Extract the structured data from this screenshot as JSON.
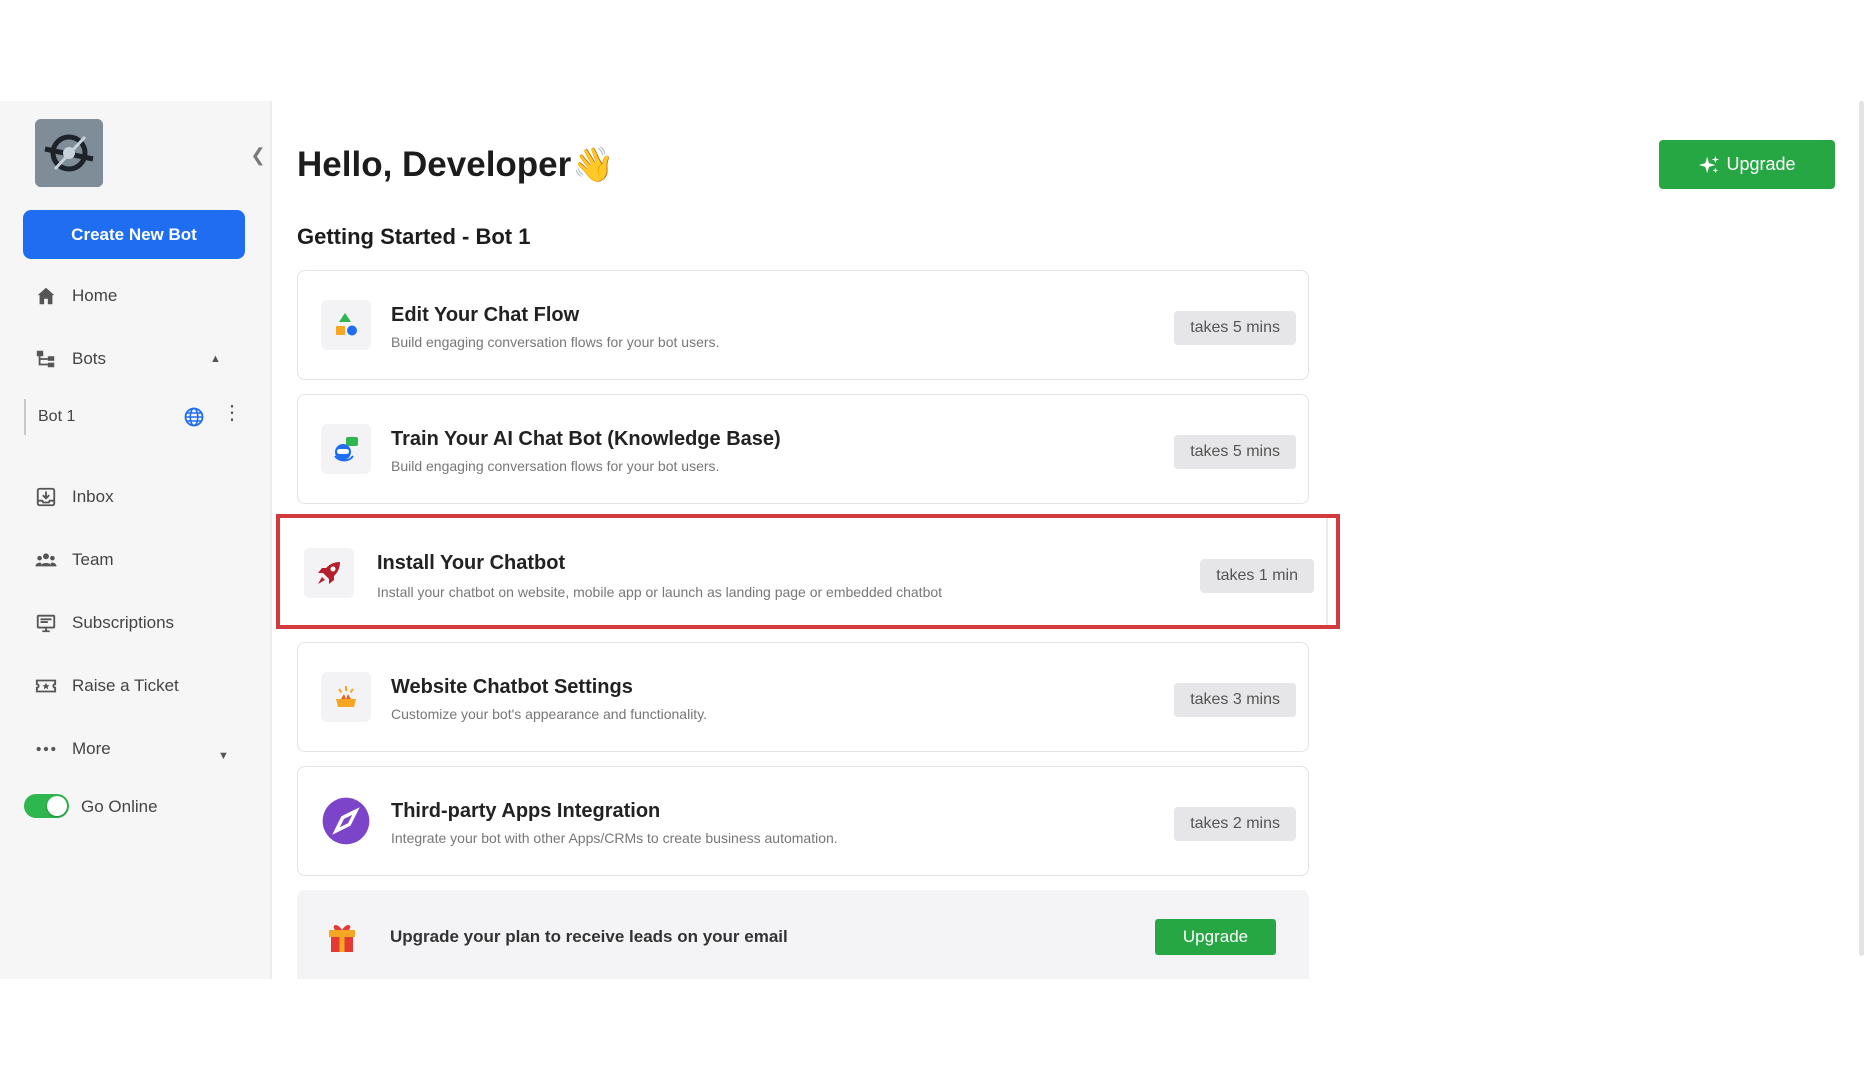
{
  "sidebar": {
    "create_label": "Create New Bot",
    "home": "Home",
    "bots": "Bots",
    "bot_name": "Bot 1",
    "inbox": "Inbox",
    "team": "Team",
    "subscriptions": "Subscriptions",
    "raise_ticket": "Raise a Ticket",
    "more": "More",
    "online_label": "Go Online",
    "online_toggle": true
  },
  "header": {
    "greeting": "Hello, Developer",
    "wave": "👋",
    "upgrade_label": "Upgrade"
  },
  "section_title": "Getting Started - Bot 1",
  "cards": [
    {
      "title": "Edit Your Chat Flow",
      "desc": "Build engaging conversation flows for your bot users.",
      "time": "takes 5 mins",
      "icon": "chat-flow-icon"
    },
    {
      "title": "Train Your AI Chat Bot (Knowledge Base)",
      "desc": "Build engaging conversation flows for your bot users.",
      "time": "takes 5 mins",
      "icon": "ai-bot-icon"
    },
    {
      "title": "Install Your Chatbot",
      "desc": "Install your chatbot on website, mobile app or launch as landing page or embedded chatbot",
      "time": "takes 1 min",
      "icon": "rocket-icon"
    },
    {
      "title": "Website Chatbot Settings",
      "desc": "Customize your bot's appearance and functionality.",
      "time": "takes 3 mins",
      "icon": "settings-sparkle-icon"
    },
    {
      "title": "Third-party Apps Integration",
      "desc": "Integrate your bot with other Apps/CRMs to create business automation.",
      "time": "takes 2 mins",
      "icon": "compass-icon"
    }
  ],
  "promo": {
    "text": "Upgrade your plan to receive leads on your email",
    "button": "Upgrade"
  },
  "colors": {
    "primary_blue": "#1f6ef2",
    "green": "#27a744",
    "highlight_red": "#d33a3e"
  }
}
